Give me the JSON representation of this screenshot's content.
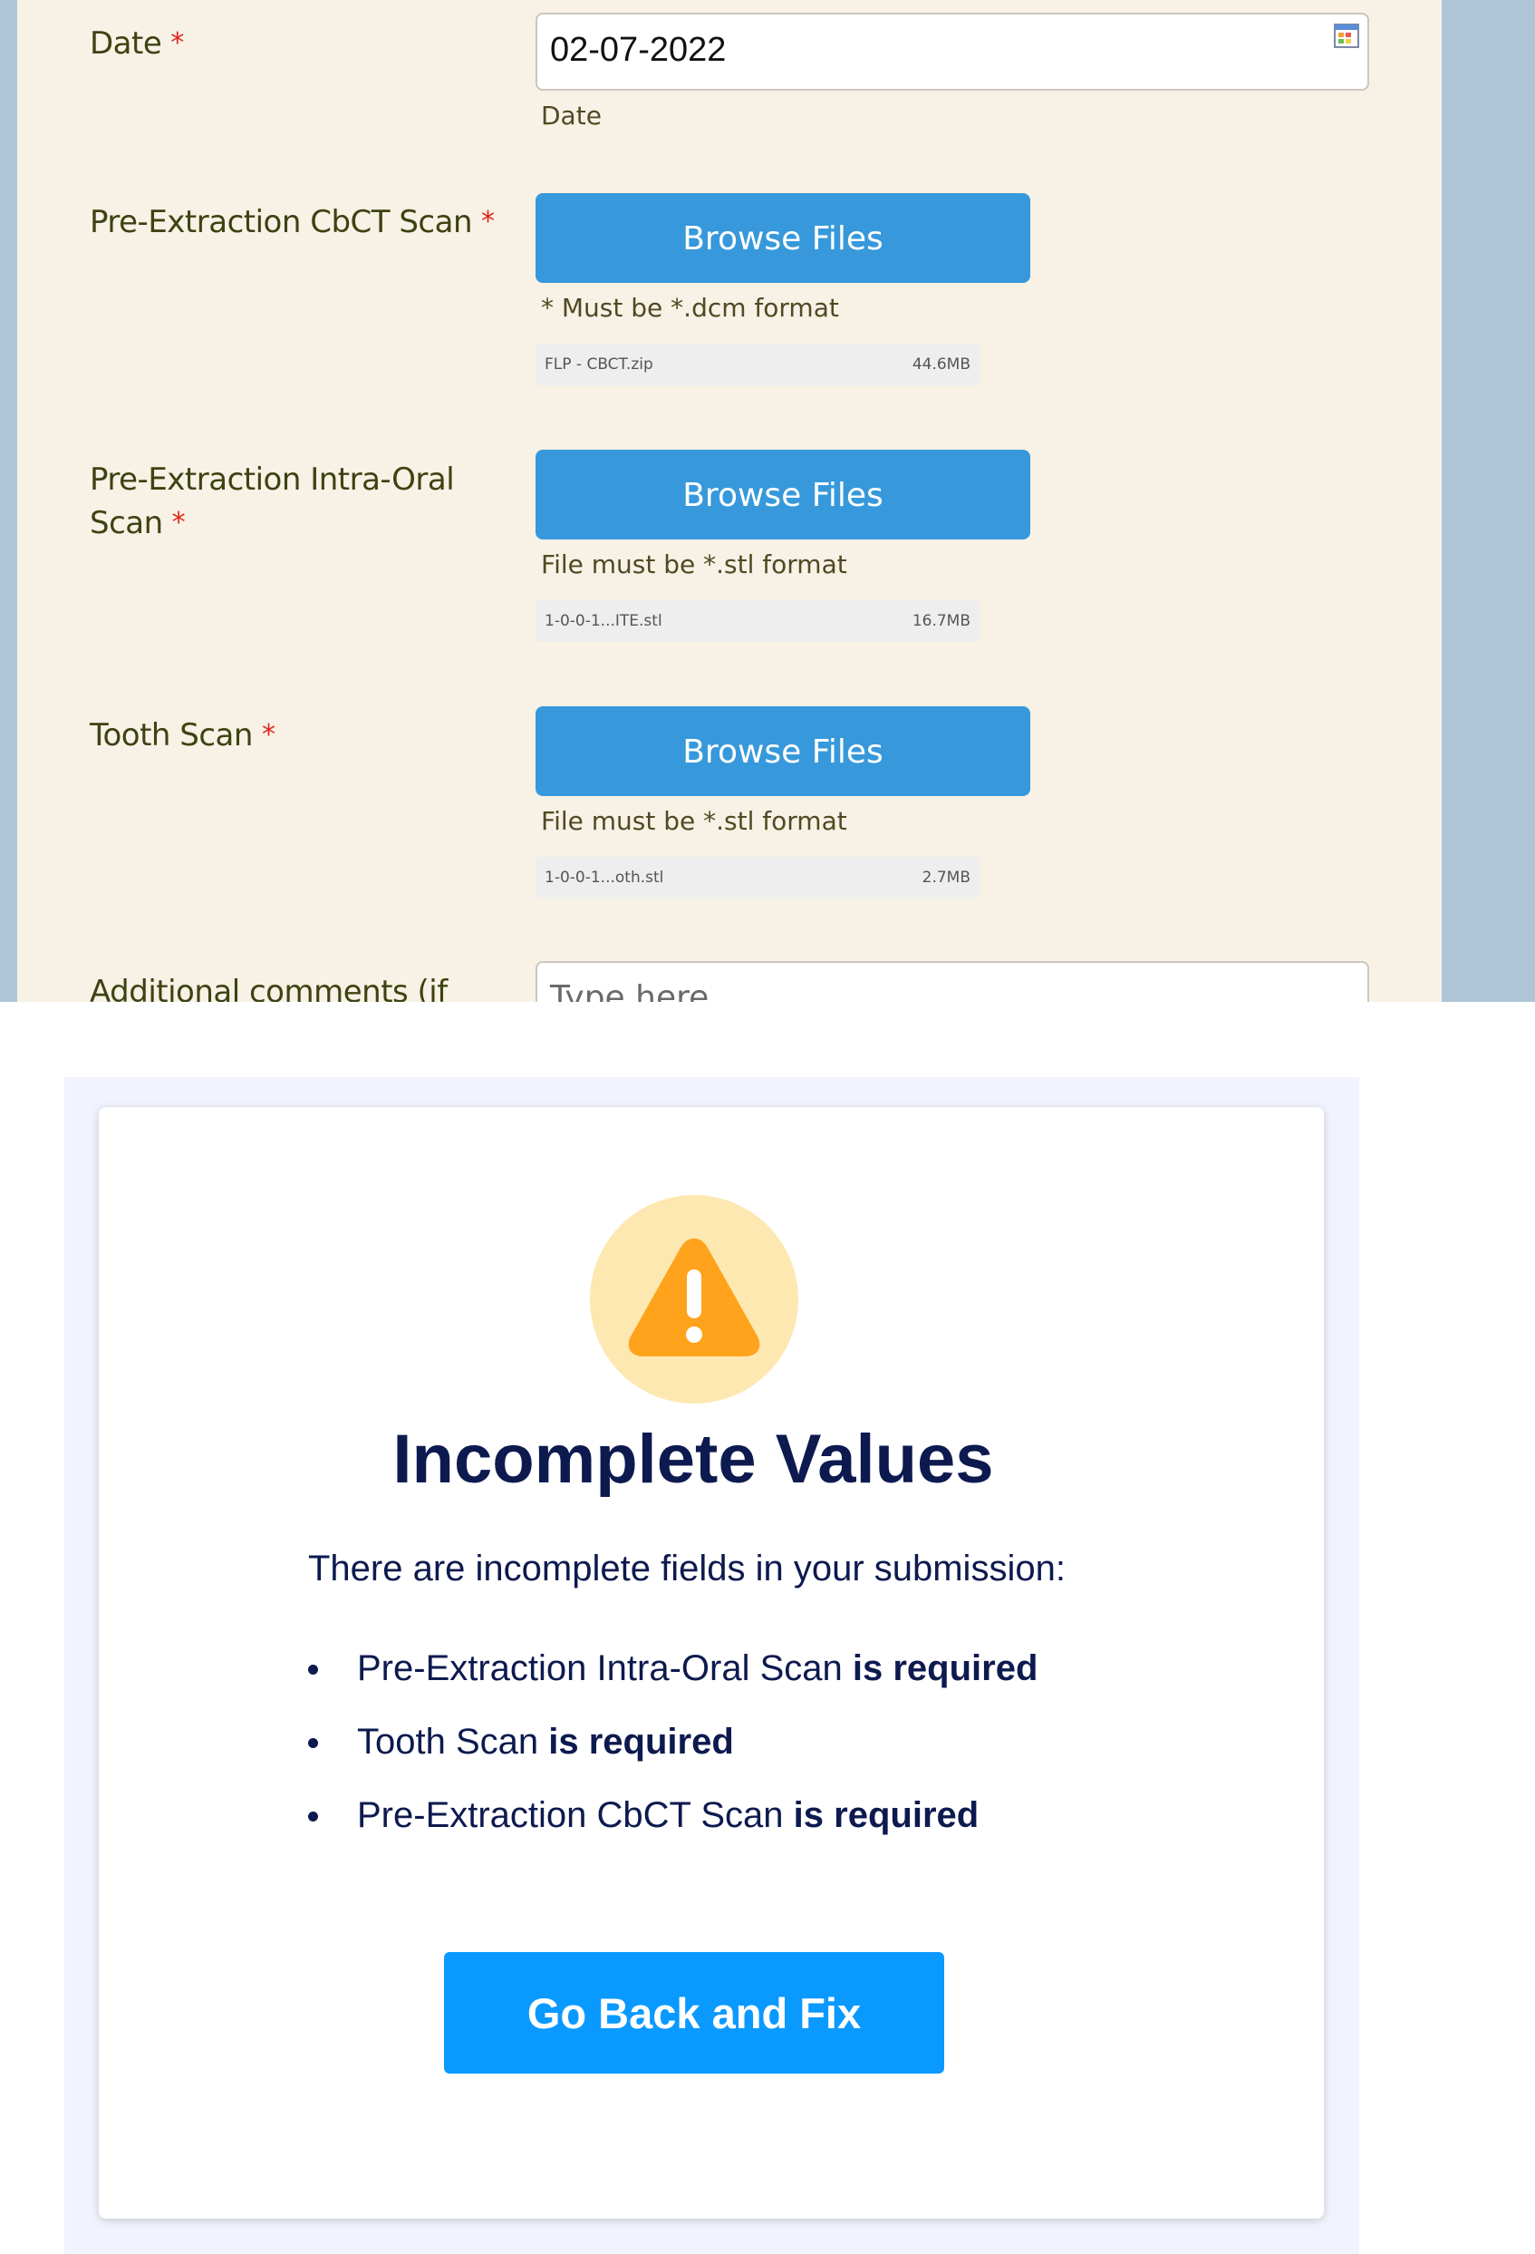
{
  "form": {
    "required_marker": "*",
    "date": {
      "label": "Date",
      "value": "02-07-2022",
      "sublabel": "Date",
      "icon": "calendar-icon"
    },
    "cbct": {
      "label": "Pre-Extraction CbCT Scan",
      "button": "Browse Files",
      "hint": "*  Must be *.dcm format",
      "file_name": "FLP - CBCT.zip",
      "file_size": "44.6MB"
    },
    "intraoral": {
      "label_line1": "Pre-Extraction  Intra-Oral",
      "label_line2": "Scan",
      "button": "Browse Files",
      "hint": "File must be *.stl format",
      "file_name": "1-0-0-1...ITE.stl",
      "file_size": "16.7MB"
    },
    "tooth": {
      "label": "Tooth Scan",
      "button": "Browse Files",
      "hint": "File must be *.stl format",
      "file_name": "1-0-0-1...oth.stl",
      "file_size": "2.7MB"
    },
    "comments": {
      "label": "Additional comments (if",
      "placeholder": "Type here"
    }
  },
  "modal": {
    "icon": "warning-icon",
    "title": "Incomplete Values",
    "message": "There are incomplete fields in your submission:",
    "errors": [
      {
        "field": "Pre-Extraction Intra-Oral Scan",
        "suffix": "is required"
      },
      {
        "field": "Tooth Scan",
        "suffix": "is required"
      },
      {
        "field": "Pre-Extraction CbCT Scan",
        "suffix": "is required"
      }
    ],
    "button": "Go Back and Fix"
  },
  "colors": {
    "form_bg": "#f8f1e6",
    "side_bg": "#adc5d6",
    "label": "#3c4311",
    "required": "#e0241b",
    "browse_button": "#3799db",
    "modal_bg": "#f1f3fd",
    "title": "#0d1a4f",
    "warning": "#fea31b",
    "warning_circle": "#fee8b1",
    "goback_button": "#0a99ff"
  }
}
